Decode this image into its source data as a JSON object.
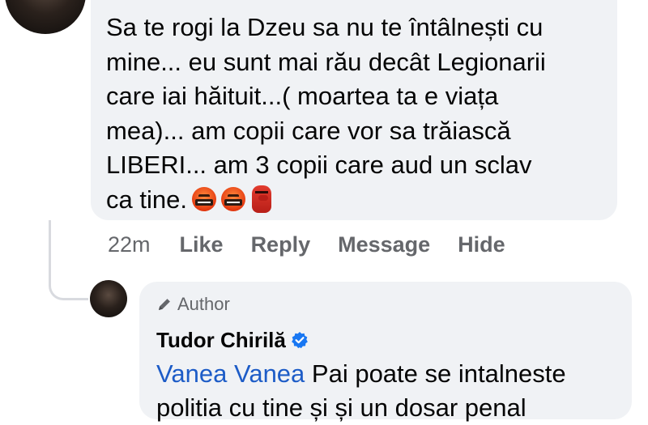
{
  "comment": {
    "lines": [
      "Sa te rogi la Dzeu sa nu te întâlnești cu",
      "mine... eu sunt mai rău decât Legionarii",
      "care iai hăituit...( moartea ta e viața",
      "mea)... am copii care vor sa trăiască",
      "LIBERI... am 3 copii care aud un sclav",
      "ca tine."
    ],
    "emojis": [
      "face-with-symbols-on-mouth-icon",
      "face-with-symbols-on-mouth-icon",
      "red-tengu-mask-icon"
    ],
    "time": "22m",
    "actions": {
      "like": "Like",
      "reply": "Reply",
      "message": "Message",
      "hide": "Hide"
    }
  },
  "reply": {
    "badge": "Author",
    "author_name": "Tudor Chirilă",
    "mention": "Vanea Vanea",
    "text": " Pai poate se intalneste",
    "text_cut": "politia cu tine și și un dosar penal"
  },
  "colors": {
    "bubble": "#f0f2f5",
    "secondary_text": "#65676b",
    "mention": "#1d5cc7",
    "verified": "#1877f2"
  }
}
